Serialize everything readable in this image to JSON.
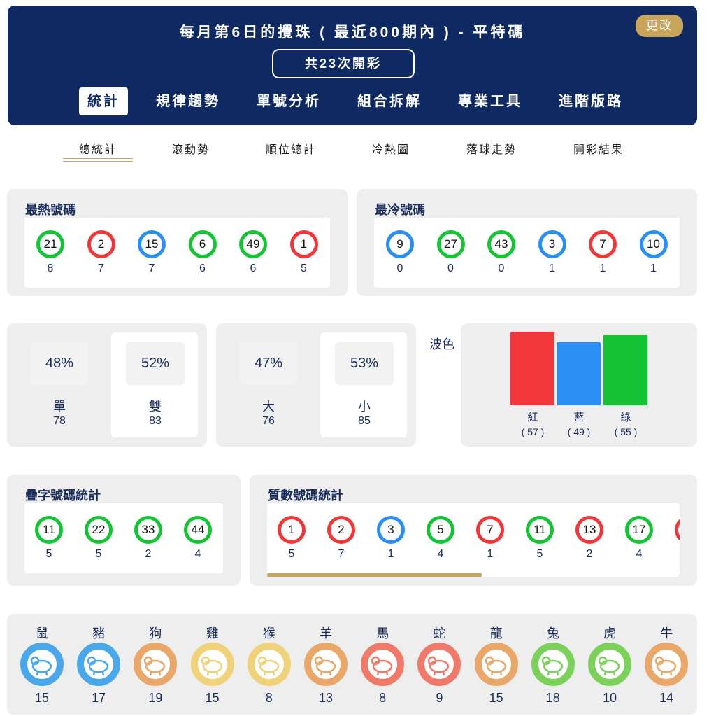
{
  "header": {
    "title": "每月第6日的攪珠 ( 最近800期內 ) - 平特碼",
    "edit_label": "更改",
    "count_label": "共23次開彩",
    "tabs": [
      "統計",
      "規律趨勢",
      "單號分析",
      "組合拆解",
      "專業工具",
      "進階版路"
    ]
  },
  "sub_tabs": [
    "總統計",
    "滾動勢",
    "順位總計",
    "冷熱圖",
    "落球走勢",
    "開彩結果"
  ],
  "hot": {
    "title": "最熱號碼",
    "balls": [
      {
        "n": "21",
        "c": "green",
        "count": "8"
      },
      {
        "n": "2",
        "c": "red",
        "count": "7"
      },
      {
        "n": "15",
        "c": "blue",
        "count": "7"
      },
      {
        "n": "6",
        "c": "green",
        "count": "6"
      },
      {
        "n": "49",
        "c": "green",
        "count": "6"
      },
      {
        "n": "1",
        "c": "red",
        "count": "5"
      }
    ]
  },
  "cold": {
    "title": "最冷號碼",
    "balls": [
      {
        "n": "9",
        "c": "blue",
        "count": "0"
      },
      {
        "n": "27",
        "c": "green",
        "count": "0"
      },
      {
        "n": "43",
        "c": "green",
        "count": "0"
      },
      {
        "n": "3",
        "c": "blue",
        "count": "1"
      },
      {
        "n": "7",
        "c": "red",
        "count": "1"
      },
      {
        "n": "10",
        "c": "blue",
        "count": "1"
      }
    ]
  },
  "odd_even": {
    "odd": {
      "pct": "48%",
      "label": "單",
      "count": "78"
    },
    "even": {
      "pct": "52%",
      "label": "雙",
      "count": "83"
    }
  },
  "big_small": {
    "big": {
      "pct": "47%",
      "label": "大",
      "count": "76"
    },
    "small": {
      "pct": "53%",
      "label": "小",
      "count": "85"
    }
  },
  "wave": {
    "title": "波色",
    "bars": [
      {
        "label": "紅",
        "value": 57,
        "value_label": "( 57 )",
        "color": "#f0383a"
      },
      {
        "label": "藍",
        "value": 49,
        "value_label": "( 49 )",
        "color": "#2a8ef2"
      },
      {
        "label": "綠",
        "value": 55,
        "value_label": "( 55 )",
        "color": "#14c435"
      }
    ]
  },
  "repeat": {
    "title": "疊字號碼統計",
    "balls": [
      {
        "n": "11",
        "c": "green",
        "count": "5"
      },
      {
        "n": "22",
        "c": "green",
        "count": "5"
      },
      {
        "n": "33",
        "c": "green",
        "count": "2"
      },
      {
        "n": "44",
        "c": "green",
        "count": "4"
      }
    ]
  },
  "prime": {
    "title": "質數號碼統計",
    "balls": [
      {
        "n": "1",
        "c": "red",
        "count": "5"
      },
      {
        "n": "2",
        "c": "red",
        "count": "7"
      },
      {
        "n": "3",
        "c": "blue",
        "count": "1"
      },
      {
        "n": "5",
        "c": "green",
        "count": "4"
      },
      {
        "n": "7",
        "c": "red",
        "count": "1"
      },
      {
        "n": "11",
        "c": "green",
        "count": "5"
      },
      {
        "n": "13",
        "c": "red",
        "count": "2"
      },
      {
        "n": "17",
        "c": "green",
        "count": "4"
      }
    ]
  },
  "zodiac": [
    {
      "name": "鼠",
      "count": "15",
      "color": "#4aa8ea",
      "icon": "rat-icon"
    },
    {
      "name": "豬",
      "count": "17",
      "color": "#4aa8ea",
      "icon": "pig-icon"
    },
    {
      "name": "狗",
      "count": "19",
      "color": "#e9a76a",
      "icon": "dog-icon"
    },
    {
      "name": "雞",
      "count": "15",
      "color": "#efd27a",
      "icon": "rooster-icon"
    },
    {
      "name": "猴",
      "count": "8",
      "color": "#efd27a",
      "icon": "monkey-icon"
    },
    {
      "name": "羊",
      "count": "13",
      "color": "#e9a76a",
      "icon": "goat-icon"
    },
    {
      "name": "馬",
      "count": "8",
      "color": "#f07a6a",
      "icon": "horse-icon"
    },
    {
      "name": "蛇",
      "count": "9",
      "color": "#f07a6a",
      "icon": "snake-icon"
    },
    {
      "name": "龍",
      "count": "15",
      "color": "#e9a76a",
      "icon": "dragon-icon"
    },
    {
      "name": "兔",
      "count": "18",
      "color": "#7bd15a",
      "icon": "rabbit-icon"
    },
    {
      "name": "虎",
      "count": "10",
      "color": "#7bd15a",
      "icon": "tiger-icon"
    },
    {
      "name": "牛",
      "count": "14",
      "color": "#e9a76a",
      "icon": "ox-icon"
    }
  ]
}
